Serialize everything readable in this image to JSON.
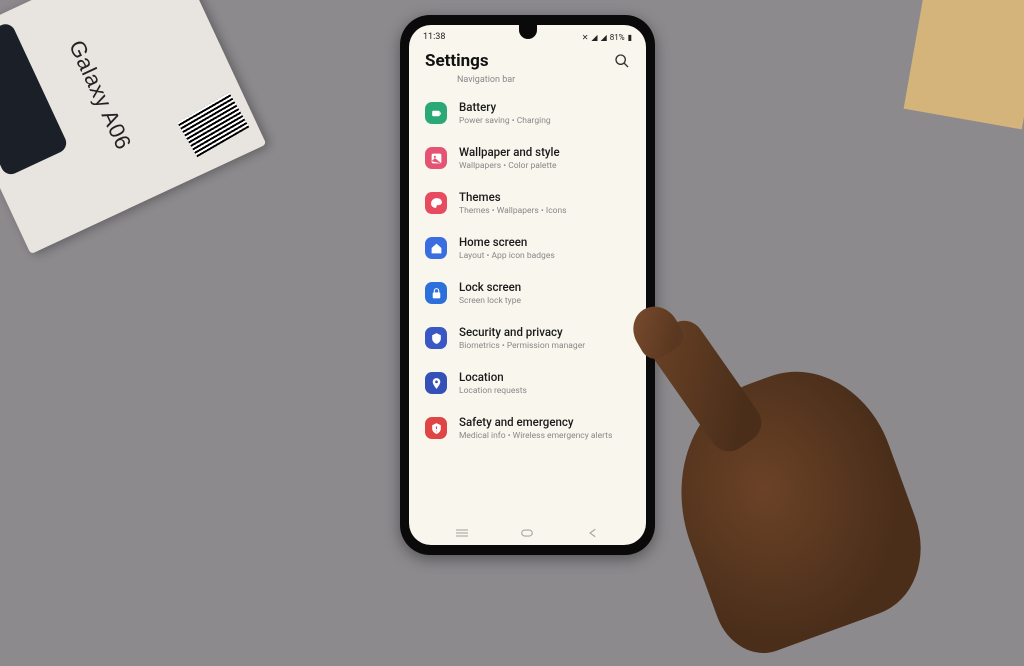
{
  "status": {
    "time": "11:38",
    "battery": "81%"
  },
  "header": {
    "title": "Settings",
    "sub": "Navigation bar"
  },
  "items": [
    {
      "title": "Battery",
      "sub": "Power saving  •  Charging"
    },
    {
      "title": "Wallpaper and style",
      "sub": "Wallpapers  •  Color palette"
    },
    {
      "title": "Themes",
      "sub": "Themes  •  Wallpapers  •  Icons"
    },
    {
      "title": "Home screen",
      "sub": "Layout  •  App icon badges"
    },
    {
      "title": "Lock screen",
      "sub": "Screen lock type"
    },
    {
      "title": "Security and privacy",
      "sub": "Biometrics  •  Permission manager"
    },
    {
      "title": "Location",
      "sub": "Location requests"
    },
    {
      "title": "Safety and emergency",
      "sub": "Medical info  •  Wireless emergency alerts"
    }
  ],
  "box": {
    "product": "Galaxy A06"
  }
}
